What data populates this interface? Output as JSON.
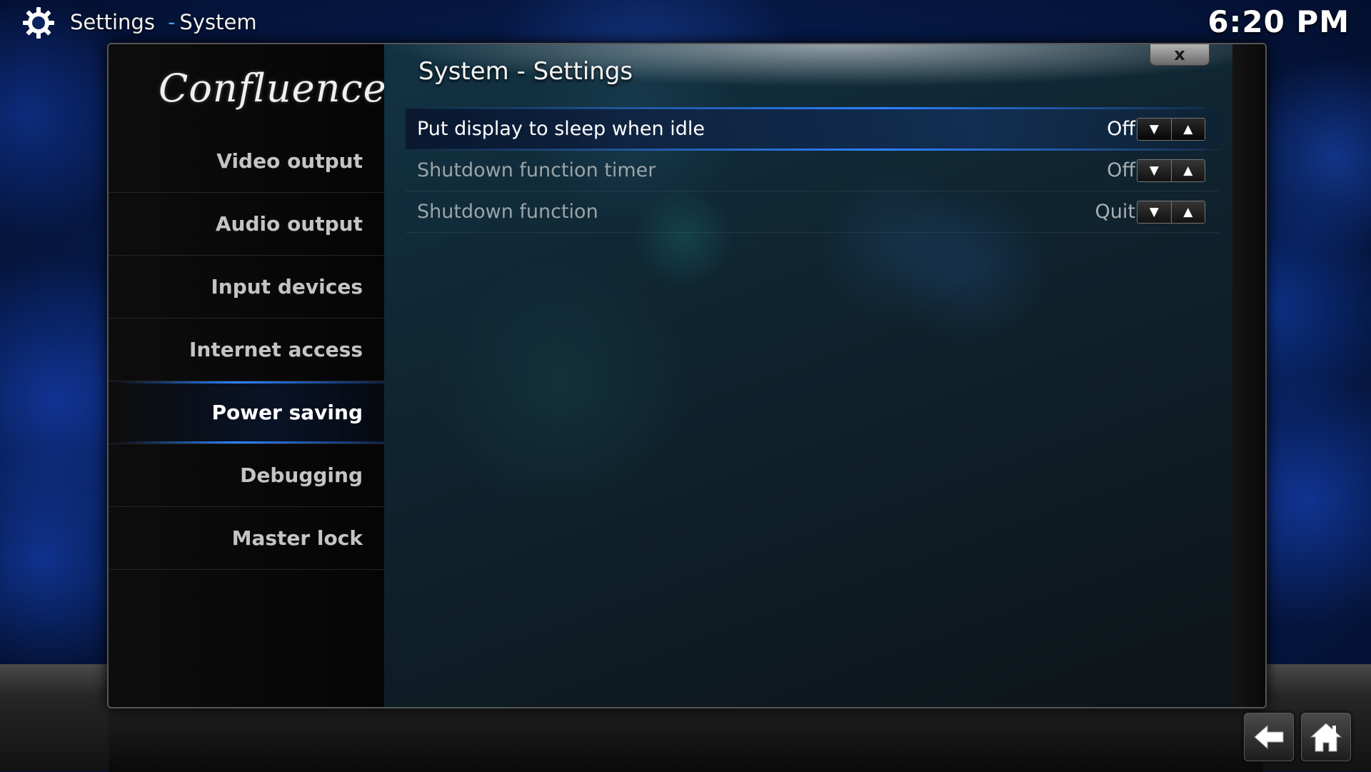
{
  "topbar": {
    "section": "Settings",
    "separator": "-",
    "page": "System",
    "clock": "6:20 PM"
  },
  "window": {
    "title": "System - Settings",
    "logo_text": "Confluence",
    "close_label": "x"
  },
  "sidebar": {
    "items": [
      {
        "label": "Video output"
      },
      {
        "label": "Audio output"
      },
      {
        "label": "Input devices"
      },
      {
        "label": "Internet access"
      },
      {
        "label": "Power saving",
        "active": true
      },
      {
        "label": "Debugging"
      },
      {
        "label": "Master lock"
      }
    ]
  },
  "settings": [
    {
      "label": "Put display to sleep when idle",
      "value": "Off"
    },
    {
      "label": "Shutdown function timer",
      "value": "Off"
    },
    {
      "label": "Shutdown function",
      "value": "Quit"
    }
  ],
  "spinner": {
    "down": "▼",
    "up": "▲"
  },
  "icons": {
    "topbar": "gear-icon",
    "back": "back-arrow-icon",
    "home": "home-icon"
  },
  "colors": {
    "accent": "#2e82ff",
    "separator": "#3e9dff"
  }
}
